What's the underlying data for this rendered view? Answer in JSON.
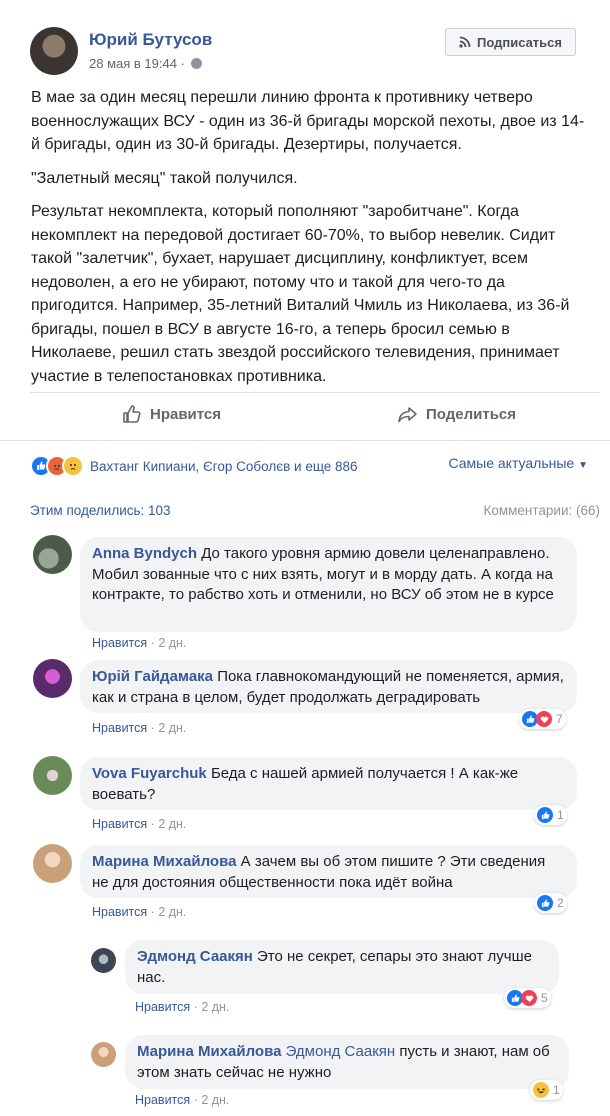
{
  "post": {
    "author": "Юрий Бутусов",
    "date": "28 мая в 19:44 ·",
    "subscribe_label": "Подписаться",
    "paragraphs": [
      "В мае за один месяц перешли линию фронта к противнику четверо военнослужащих ВСУ - один из 36-й бригады морской пехоты, двое из 14-й бригады, один из 30-й бригады. Дезертиры, получается.",
      "\"Залетный месяц\" такой получился.",
      "Результат некомплекта, который пополняют \"заробитчане\". Когда некомплект на передовой достигает 60-70%, то выбор невелик. Сидит такой \"залетчик\", бухает, нарушает дисциплину, конфликтует, всем недоволен, а его не убирают, потому что и такой для чего-то да пригодится. Например, 35-летний Виталий Чмиль из Николаева, из 36-й бригады, пошел в ВСУ в августе 16-го, а теперь бросил семью в Николаеве, решил стать звездой российского телевидения, принимает участие в телепостановках противника."
    ]
  },
  "actions": {
    "like": "Нравится",
    "share": "Поделиться"
  },
  "reactions": {
    "names": "Вахтанг Кипиани, Єгор Соболєв и еще 886",
    "sort": "Самые актуальные"
  },
  "stats": {
    "shares": "Этим поделились: 103",
    "comments": "Комментарии: (66)"
  },
  "comments": [
    {
      "author": "Anna Byndych",
      "text": "До такого уровня армию довели целенаправлено. Мобил зованные что с них взять, могут и в морду дать. А когда на контракте, то рабство хоть и отменили, но ВСУ об этом не в курсе",
      "like": "Нравится",
      "time": "2 дн.",
      "avatar_color": "#6b7a6a"
    },
    {
      "author": "Юрій Гайдамака",
      "text": "Пока главнокомандующий не поменяется, армия, как и страна в целом, будет продолжать деградировать",
      "like": "Нравится",
      "time": "2 дн.",
      "count": "7",
      "avatar_color": "#7a2f8a"
    },
    {
      "author": "Vova Fuyarchuk",
      "text": "Беда с нашей армией получается ! А как-же воевать?",
      "like": "Нравится",
      "time": "2 дн.",
      "count": "1",
      "avatar_color": "#5b7a4e"
    },
    {
      "author": "Марина Михайлова",
      "text": "А зачем вы об этом пишите ? Эти сведения не для достояния общественности пока идёт война",
      "like": "Нравится",
      "time": "2 дн.",
      "count": "2",
      "avatar_color": "#c9b49a"
    }
  ],
  "replies": [
    {
      "author": "Эдмонд Саакян",
      "text": "Это не секрет, сепары это знают лучше нас.",
      "like": "Нравится",
      "time": "2 дн.",
      "count": "5",
      "avatar_color": "#4a5566"
    },
    {
      "author": "Марина Михайлова",
      "mention": "Эдмонд Саакян",
      "text": "пусть и знают, нам об этом знать сейчас не нужно",
      "like": "Нравится",
      "time": "2 дн.",
      "count": "1",
      "avatar_color": "#c9b49a"
    }
  ],
  "separator": "·"
}
